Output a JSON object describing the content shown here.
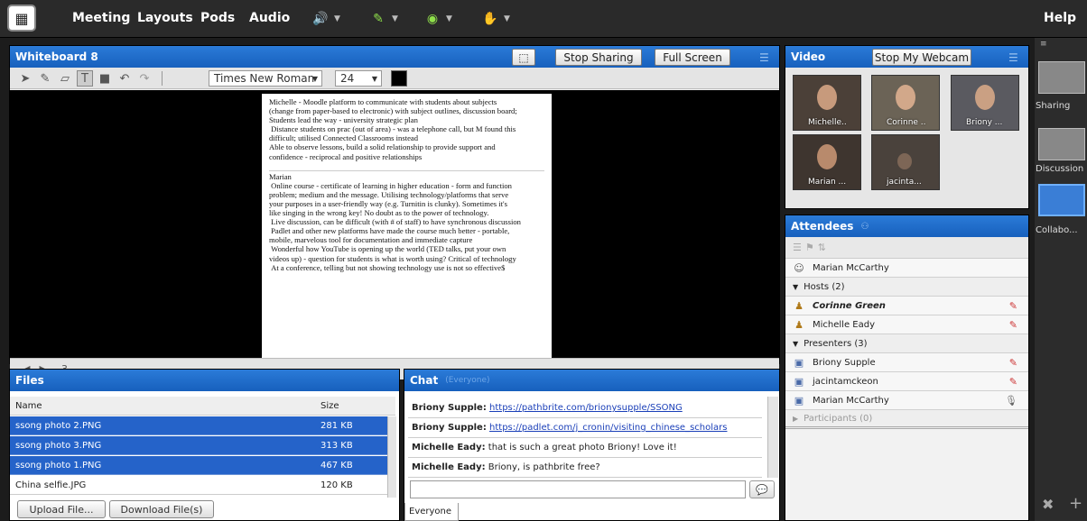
{
  "menubar": {
    "items": [
      "Meeting",
      "Layouts",
      "Pods",
      "Audio"
    ],
    "help": "Help"
  },
  "whiteboard": {
    "title": "Whiteboard 8",
    "stop_sharing": "Stop Sharing",
    "full_screen": "Full Screen",
    "font": "Times New Roman",
    "font_size": "24",
    "page_number": "3",
    "text_block1": "Michelle - Moodle platform to communicate with students about subjects\n(change from paper-based to electronic) with subject outlines, discussion board;\nStudents lead the way - university strategic plan\n Distance students on prac (out of area) - was a telephone call, but M found this\ndifficult; utilised Connected Classrooms instead\nAble to observe lessons, build a solid relationship to provide support and\nconfidence - reciprocal and positive relationships",
    "text_block2": "Marian\n Online course - certificate of learning in higher education - form and function\nproblem; medium and the message. Utilising technology/platforms that serve\nyour purposes in a user-friendly way (e.g. Turnitin is clunky). Sometimes it's\nlike singing in the wrong key! No doubt as to the power of technology.\n Live discussion, can be difficult (with # of staff) to have synchronous discussion\n Padlet and other new platforms have made the course much better - portable,\nmobile, marvelous tool for documentation and immediate capture\n Wonderful how YouTube is opening up the world (TED talks, put your own\nvideos up) - question for students is what is worth using? Critical of technology\n At a conference, telling but not showing technology use is not so effective$"
  },
  "video": {
    "title": "Video",
    "stop_webcam": "Stop My Webcam",
    "participants": [
      "Michelle..",
      "Corinne ..",
      "Briony ...",
      "Marian ...",
      "jacinta..."
    ]
  },
  "attendees": {
    "title": "Attendees",
    "me": "Marian McCarthy",
    "hosts_header": "Hosts (2)",
    "hosts": [
      "Corinne Green",
      "Michelle Eady"
    ],
    "presenters_header": "Presenters (3)",
    "presenters": [
      "Briony Supple",
      "jacintamckeon",
      "Marian McCarthy"
    ],
    "participants_header": "Participants (0)"
  },
  "files": {
    "title": "Files",
    "col_name": "Name",
    "col_size": "Size",
    "rows": [
      {
        "name": "ssong photo 2.PNG",
        "size": "281 KB"
      },
      {
        "name": "ssong photo 3.PNG",
        "size": "313 KB"
      },
      {
        "name": "ssong photo 1.PNG",
        "size": "467 KB"
      },
      {
        "name": "China selfie.JPG",
        "size": "120 KB"
      }
    ],
    "upload": "Upload File...",
    "download": "Download File(s)"
  },
  "chat": {
    "title": "Chat",
    "subtitle": "(Everyone)",
    "messages": [
      {
        "who": "Briony Supple:",
        "text": "https://pathbrite.com/brionysupple/SSONG",
        "link": true
      },
      {
        "who": "Briony Supple:",
        "text": "https://padlet.com/j_cronin/visiting_chinese_scholars",
        "link": true
      },
      {
        "who": "Michelle Eady:",
        "text": "that is such a great photo Briony! Love it!",
        "link": false
      },
      {
        "who": "Michelle Eady:",
        "text": "Briony, is pathbrite free?",
        "link": false
      }
    ],
    "tab": "Everyone"
  },
  "rail": {
    "layouts": [
      "Sharing",
      "Discussion",
      "Collabo..."
    ]
  },
  "colors": {
    "pod_header": "#1d67c6",
    "selection": "#2563c9"
  }
}
